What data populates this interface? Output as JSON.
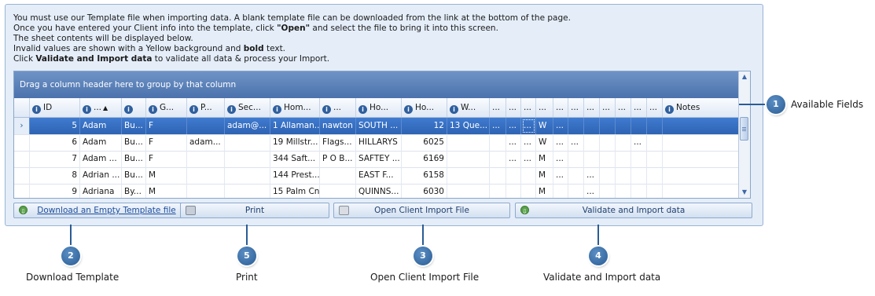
{
  "intro": {
    "line1": "You must use our Template file when importing data. A blank template file can be downloaded from the link at the bottom of the page.",
    "line2_pre": "Once you have entered your Client info into the template, click ",
    "line2_bold": "\"Open\"",
    "line2_post": " and select the file to bring it into this screen.",
    "line3": "The sheet contents will be displayed below.",
    "line4_pre": "Invalid values are shown with a Yellow background and ",
    "line4_bold": "bold",
    "line4_post": " text.",
    "line5_pre": " Click ",
    "line5_bold": "Validate and Import data",
    "line5_post": " to validate all data & process your Import."
  },
  "grid": {
    "group_bar_text": "Drag a column header here to group by that column",
    "headers": [
      "ID",
      "...",
      "",
      "G...",
      "P...",
      "Sec...",
      "Hom...",
      "...",
      "Ho...",
      "Ho...",
      "W...",
      "...",
      "...",
      "...",
      "...",
      "...",
      "...",
      "...",
      "...",
      "...",
      "...",
      "...",
      "Notes"
    ],
    "sort_indicator": "▲",
    "rows": [
      {
        "cells": [
          "5",
          "Adam",
          "Bu...",
          "F",
          "",
          "adam@...",
          "1 Allaman...",
          "nawton",
          "SOUTH ...",
          "12",
          "13 Que...",
          "...",
          "...",
          "...",
          "W",
          "...",
          "",
          "",
          "",
          "",
          "",
          "",
          ""
        ],
        "selected": true
      },
      {
        "cells": [
          "6",
          "Adam",
          "Bu...",
          "F",
          "adam...",
          "",
          "19 Millstr...",
          "Flags...",
          "HILLARYS",
          "6025",
          "",
          "",
          "...",
          "...",
          "W",
          "...",
          "...",
          "",
          "",
          "",
          "...",
          "",
          ""
        ],
        "selected": false
      },
      {
        "cells": [
          "7",
          "Adam ...",
          "Bu...",
          "F",
          "",
          "",
          "344 Saft...",
          "P O B...",
          "SAFTEY ...",
          "6169",
          "",
          "",
          "...",
          "...",
          "M",
          "...",
          "",
          "",
          "",
          "",
          "",
          "",
          ""
        ],
        "selected": false
      },
      {
        "cells": [
          "8",
          "Adrian ...",
          "Bu...",
          "M",
          "",
          "",
          "144 Prest...",
          "",
          "EAST F...",
          "6158",
          "",
          "",
          "",
          "",
          "M",
          "...",
          "",
          "...",
          "",
          "",
          "",
          "",
          ""
        ],
        "selected": false
      },
      {
        "cells": [
          "9",
          "Adriana",
          "By...",
          "M",
          "",
          "",
          "15 Palm Cnr",
          "",
          "QUINNS...",
          "6030",
          "",
          "",
          "",
          "",
          "M",
          "",
          "",
          "...",
          "",
          "",
          "",
          "",
          ""
        ],
        "selected": false
      }
    ]
  },
  "buttons": {
    "download": "Download an Empty Template file",
    "print": "Print",
    "open": "Open Client Import File",
    "validate": "Validate and Import data"
  },
  "callouts": [
    {
      "num": "1",
      "label": "Available Fields"
    },
    {
      "num": "2",
      "label": "Download Template"
    },
    {
      "num": "5",
      "label": "Print"
    },
    {
      "num": "3",
      "label": "Open Client Import File"
    },
    {
      "num": "4",
      "label": "Validate and Import data"
    }
  ],
  "colors": {
    "accent": "#2a5c94",
    "selected_row": "#3169b8",
    "panel_bg": "#e4edf8"
  }
}
